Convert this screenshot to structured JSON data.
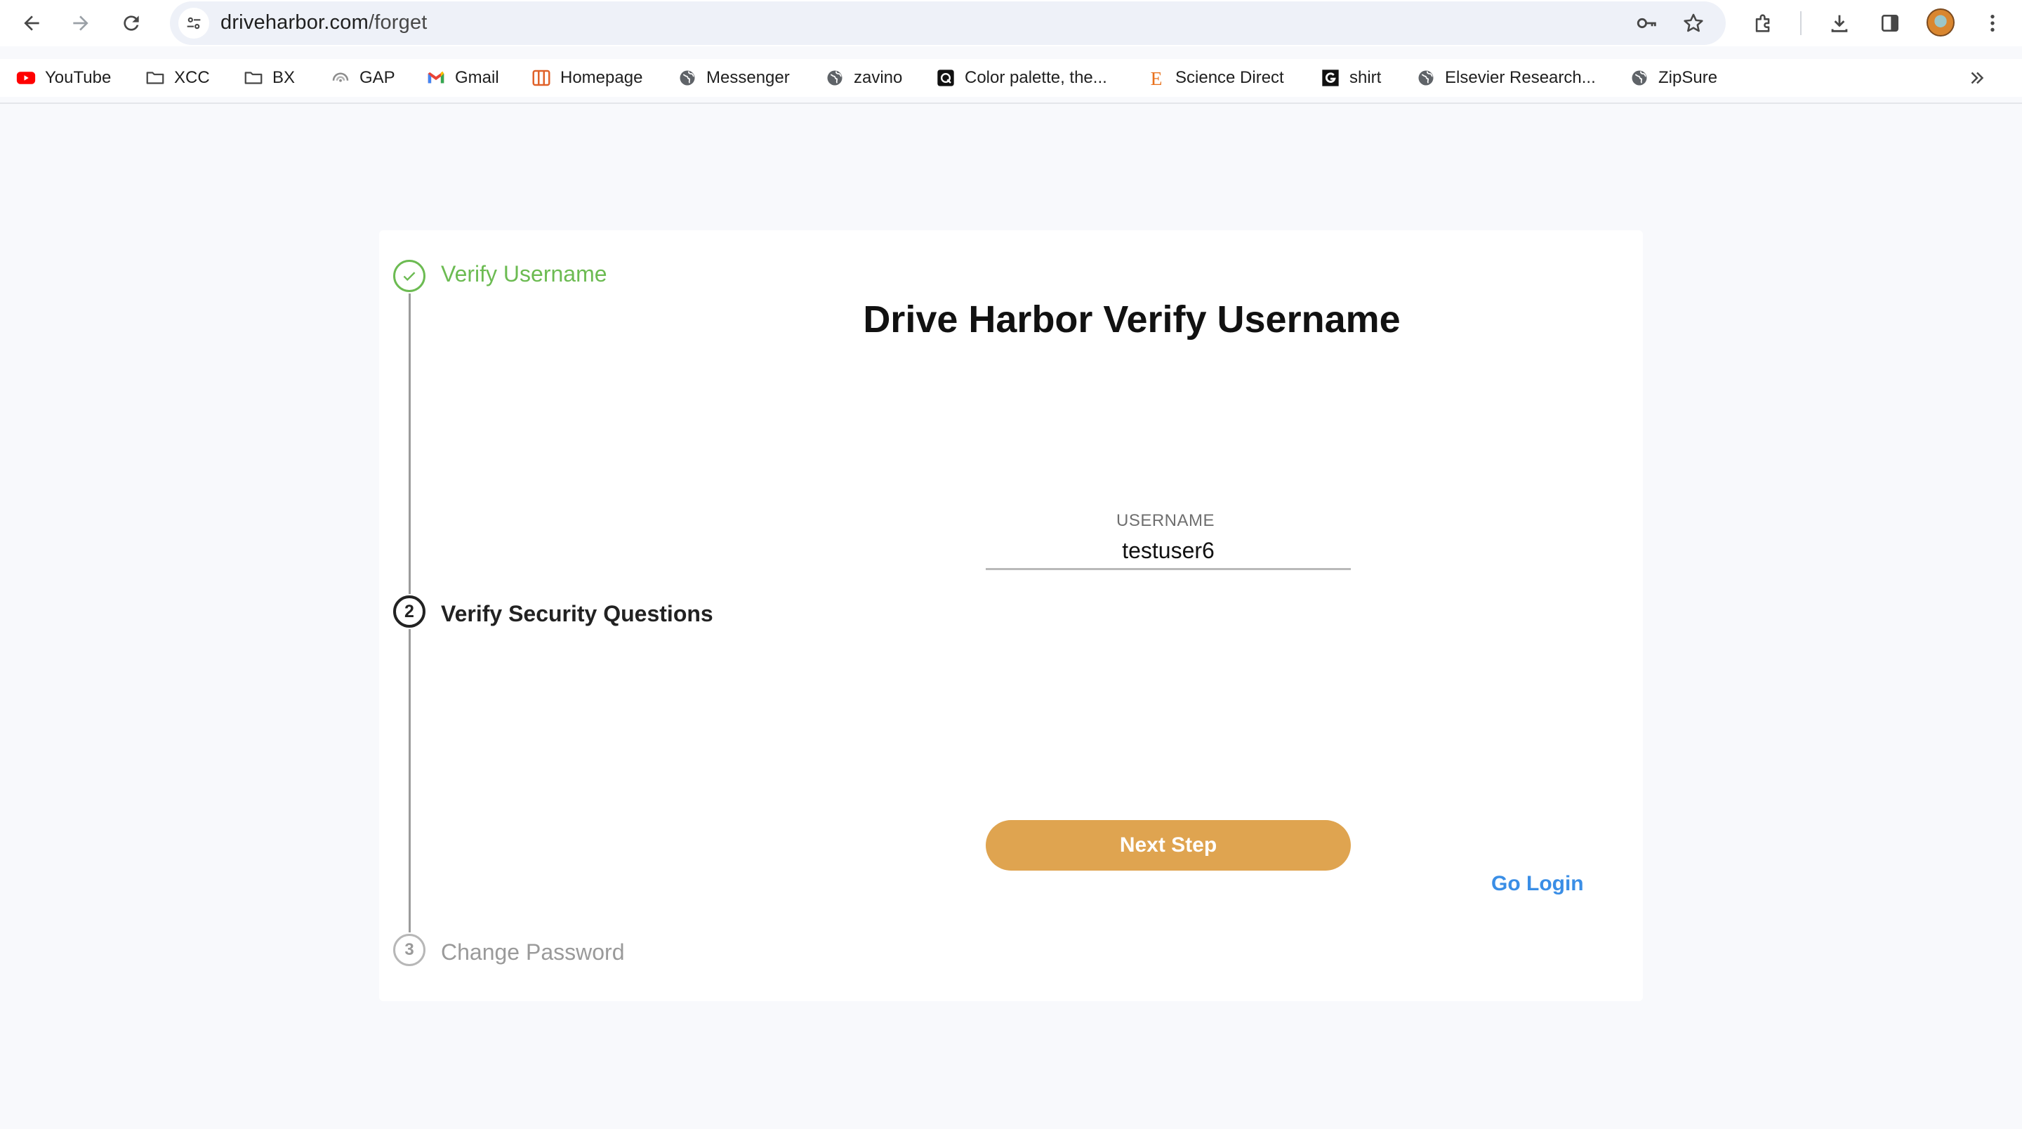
{
  "browser": {
    "url_domain": "driveharbor.com",
    "url_path": "/forget",
    "bookmarks": [
      {
        "label": "YouTube",
        "icon": "youtube-icon"
      },
      {
        "label": "XCC",
        "icon": "folder-icon"
      },
      {
        "label": "BX",
        "icon": "folder-icon"
      },
      {
        "label": "GAP",
        "icon": "gap-icon"
      },
      {
        "label": "Gmail",
        "icon": "gmail-icon"
      },
      {
        "label": "Homepage",
        "icon": "homepage-icon"
      },
      {
        "label": "Messenger",
        "icon": "globe-icon"
      },
      {
        "label": "zavino",
        "icon": "globe-icon"
      },
      {
        "label": "Color palette, the...",
        "icon": "color-palette-icon"
      },
      {
        "label": "Science Direct",
        "icon": "science-direct-icon"
      },
      {
        "label": "shirt",
        "icon": "shirt-g-icon"
      },
      {
        "label": "Elsevier Research...",
        "icon": "globe-icon"
      },
      {
        "label": "ZipSure",
        "icon": "globe-icon"
      }
    ]
  },
  "steps": [
    {
      "number": "✓",
      "label": "Verify Username",
      "state": "completed",
      "color": "#6cbb52"
    },
    {
      "number": "2",
      "label": "Verify Security Questions",
      "state": "active",
      "color": "#222222"
    },
    {
      "number": "3",
      "label": "Change Password",
      "state": "pending",
      "color": "#9a9a9a"
    }
  ],
  "main": {
    "title": "Drive Harbor Verify Username",
    "username_label": "USERNAME",
    "username_value": "testuser6",
    "next_button": "Next Step",
    "go_login": "Go Login"
  },
  "colors": {
    "accent_button": "#dfa450",
    "link": "#3a8ee6",
    "success": "#6cbb52"
  }
}
